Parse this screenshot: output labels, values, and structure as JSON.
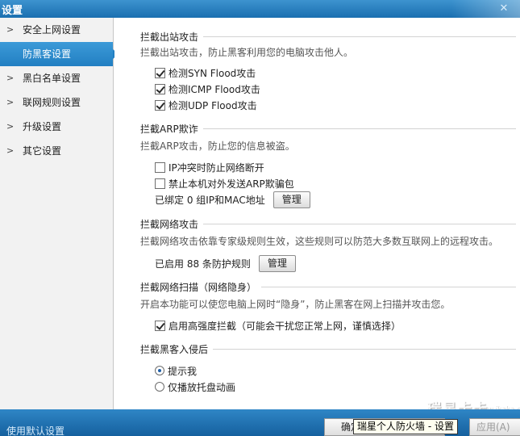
{
  "window": {
    "title": "设置",
    "close_icon": "✕"
  },
  "sidebar": {
    "items": [
      {
        "label": "安全上网设置",
        "active": false
      },
      {
        "label": "防黑客设置",
        "active": true
      },
      {
        "label": "黑白名单设置",
        "active": false
      },
      {
        "label": "联网规则设置",
        "active": false
      },
      {
        "label": "升级设置",
        "active": false
      },
      {
        "label": "其它设置",
        "active": false
      }
    ]
  },
  "outbound": {
    "title": "拦截出站攻击",
    "desc": "拦截出站攻击，防止黑客利用您的电脑攻击他人。",
    "options": [
      {
        "label": "检测SYN Flood攻击",
        "checked": true
      },
      {
        "label": "检测ICMP Flood攻击",
        "checked": true
      },
      {
        "label": "检测UDP Flood攻击",
        "checked": true
      }
    ]
  },
  "arp": {
    "title": "拦截ARP欺诈",
    "desc": "拦截ARP攻击，防止您的信息被盗。",
    "options": [
      {
        "label": "IP冲突时防止网络断开",
        "checked": false
      },
      {
        "label": "禁止本机对外发送ARP欺骗包",
        "checked": false
      }
    ],
    "bound_text": "已绑定 0 组IP和MAC地址",
    "manage_label": "管理"
  },
  "network_attack": {
    "title": "拦截网络攻击",
    "desc": "拦截网络攻击依靠专家级规则生效，这些规则可以防范大多数互联网上的远程攻击。",
    "rules_text": "已启用 88 条防护规则",
    "manage_label": "管理"
  },
  "scan": {
    "title": "拦截网络扫描（网络隐身）",
    "desc": "开启本功能可以使您电脑上网时“隐身”，防止黑客在网上扫描并攻击您。",
    "option": {
      "label": "启用高强度拦截（可能会干扰您正常上网，谨慎选择）",
      "checked": true
    }
  },
  "intrusion": {
    "title": "拦截黑客入侵后",
    "options": [
      {
        "label": "提示我",
        "selected": true
      },
      {
        "label": "仅播放托盘动画",
        "selected": false
      }
    ]
  },
  "footer": {
    "defaults_label": "使用默认设置",
    "ok_label": "确定",
    "apply_label": "应用(A)",
    "tooltip": "瑞星个人防火墙 - 设置",
    "logo_text": "瑞星卡卡",
    "logo_url": "www.ikaka.com"
  }
}
